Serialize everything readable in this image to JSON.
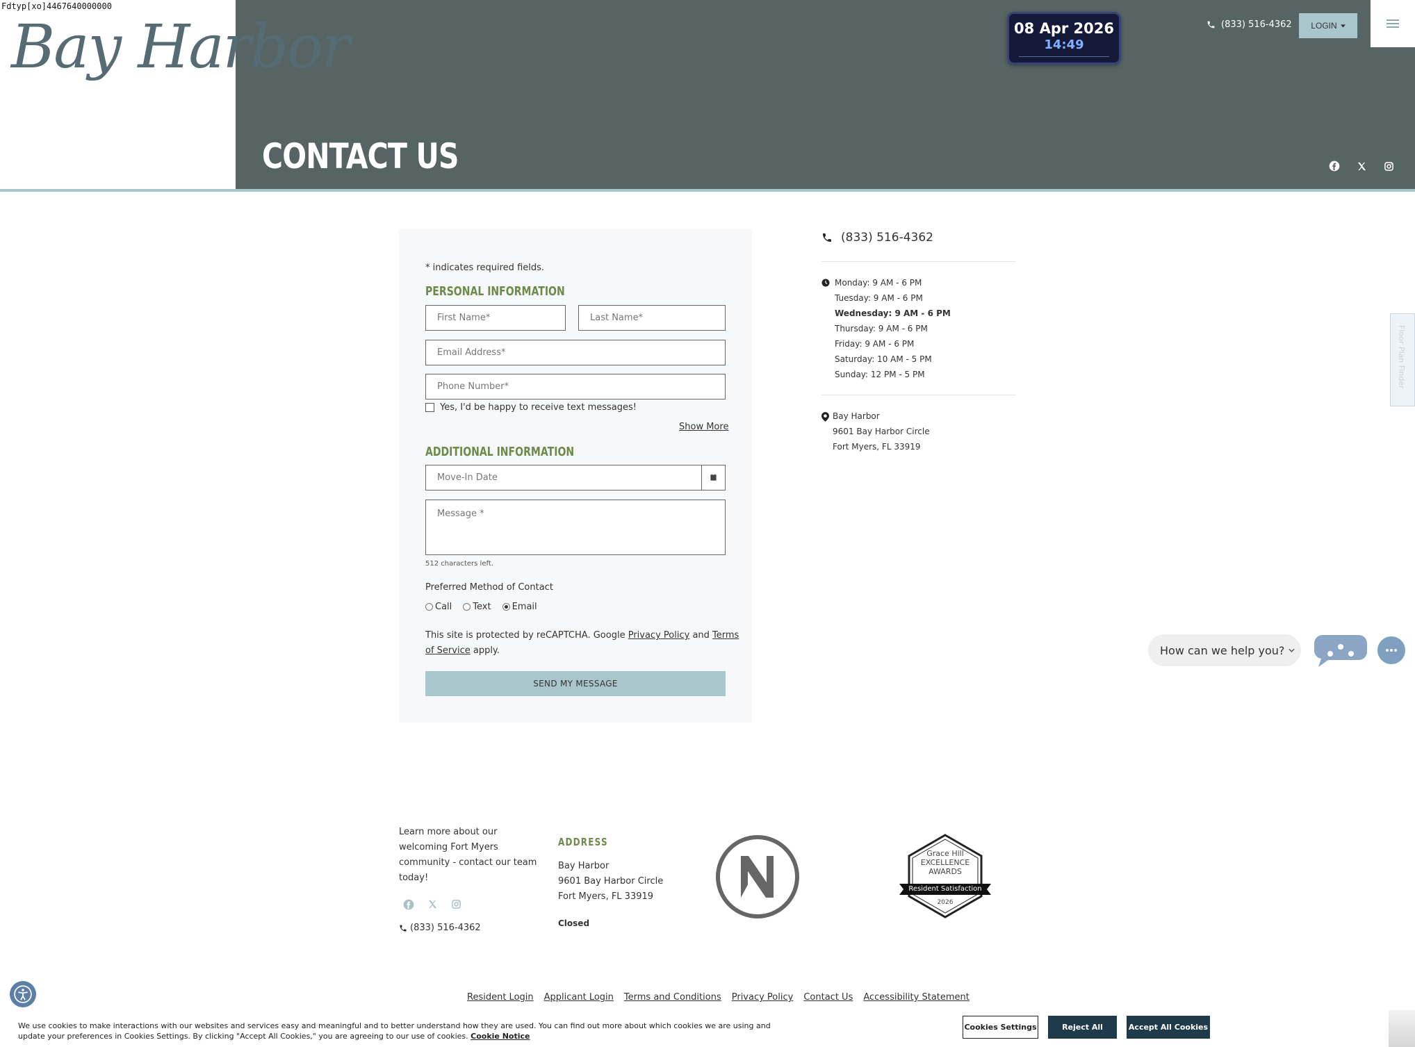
{
  "debug_text": "Fdtyp[xo]4467640000000",
  "header": {
    "logo_text": "Bay Harbor",
    "page_title": "CONTACT US",
    "phone": "(833) 516-4362",
    "login_label": "LOGIN",
    "clock": {
      "date": "08 Apr 2026",
      "time": "14:49"
    }
  },
  "form": {
    "required_note": "* indicates required fields.",
    "personal_heading": "PERSONAL INFORMATION",
    "first_name_placeholder": "First Name*",
    "last_name_placeholder": "Last Name*",
    "email_placeholder": "Email Address*",
    "phone_placeholder": "Phone Number*",
    "text_opt_in_label": "Yes, I'd be happy to receive text messages!",
    "show_more_label": "Show More",
    "additional_heading": "ADDITIONAL INFORMATION",
    "move_in_placeholder": "Move-In Date",
    "message_placeholder": "Message *",
    "chars_left": "512 characters left.",
    "preferred_contact_label": "Preferred Method of Contact",
    "contact_options": [
      {
        "label": "Call",
        "selected": false
      },
      {
        "label": "Text",
        "selected": false
      },
      {
        "label": "Email",
        "selected": true
      }
    ],
    "recaptcha_prefix": "This site is protected by reCAPTCHA. Google ",
    "privacy_policy_link": "Privacy Policy",
    "recaptcha_and": " and ",
    "terms_link_line1": "Terms",
    "terms_link_line2": "of Service",
    "recaptcha_suffix": " apply.",
    "send_label": "SEND MY MESSAGE"
  },
  "contact": {
    "phone": "(833) 516-4362",
    "hours": [
      {
        "text": "Monday: 9 AM - 6 PM",
        "current": false
      },
      {
        "text": "Tuesday: 9 AM - 6 PM",
        "current": false
      },
      {
        "text": "Wednesday: 9 AM - 6 PM",
        "current": true
      },
      {
        "text": "Thursday: 9 AM - 6 PM",
        "current": false
      },
      {
        "text": "Friday: 9 AM - 6 PM",
        "current": false
      },
      {
        "text": "Saturday: 10 AM - 5 PM",
        "current": false
      },
      {
        "text": "Sunday: 12 PM - 5 PM",
        "current": false
      }
    ],
    "address_lines": [
      "Bay Harbor",
      "9601 Bay Harbor Circle",
      "Fort Myers, FL 33919"
    ]
  },
  "side_tab_label": "Floor Plan Finder",
  "chat": {
    "prompt": "How can we help you?"
  },
  "footer": {
    "blurb_lines": [
      "Learn more about our",
      "welcoming Fort Myers",
      "community - contact our team",
      "today!"
    ],
    "phone": "(833) 516-4362",
    "address_heading": "ADDRESS",
    "address_lines": [
      "Bay Harbor",
      "9601 Bay Harbor Circle",
      "Fort Myers, FL 33919"
    ],
    "status": "Closed",
    "award": {
      "line1": "Grace Hill",
      "line2": "EXCELLENCE",
      "line3": "AWARDS",
      "ribbon": "Resident Satisfaction",
      "year": "2026"
    },
    "links": [
      "Resident Login",
      "Applicant Login",
      "Terms and Conditions",
      "Privacy Policy",
      "Contact Us",
      "Accessibility Statement"
    ]
  },
  "cookie": {
    "text": "We use cookies to make interactions with our websites and services easy and meaningful and to better understand how they are used. You can find out more about which cookies we are using and update your preferences in Cookies Settings. By clicking \"Accept All Cookies,\" you are agreeing to our use of cookies.",
    "notice_link": "Cookie Notice",
    "settings_label": "Cookies Settings",
    "reject_label": "Reject All",
    "accept_label": "Accept All Cookies"
  },
  "colors": {
    "header_bg": "#566564",
    "accent_blue": "#a9c6cd",
    "heading_green": "#6c8a4a",
    "cookie_button": "#1f3a4a"
  },
  "icons": [
    "phone-icon",
    "caret-down-icon",
    "hamburger-icon",
    "facebook-icon",
    "x-twitter-icon",
    "instagram-icon",
    "calendar-icon",
    "clock-icon",
    "map-pin-icon",
    "chat-icon",
    "more-icon",
    "accessibility-icon",
    "chevron-down-icon"
  ]
}
